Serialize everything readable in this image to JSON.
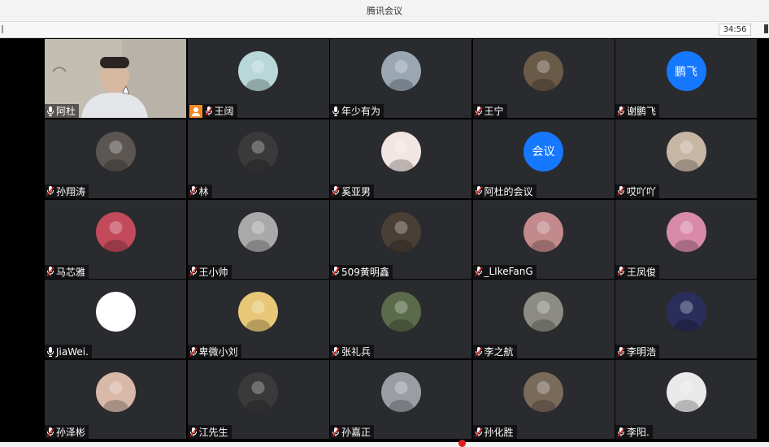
{
  "window": {
    "title": "腾讯会议",
    "timer": "34:56"
  },
  "participants": [
    {
      "name": "阿杜",
      "mic": "on",
      "type": "video"
    },
    {
      "name": "王阔",
      "mic": "muted",
      "type": "photo",
      "host": true,
      "avatar_color": "#b9d6d8"
    },
    {
      "name": "年少有为",
      "mic": "on",
      "type": "photo",
      "avatar_color": "#9aa6b2"
    },
    {
      "name": "王宁",
      "mic": "muted",
      "type": "photo",
      "avatar_color": "#6a5a48"
    },
    {
      "name": "谢鹏飞",
      "mic": "muted",
      "type": "text",
      "avatar_text": "鹏飞",
      "avatar_color": "#1677ff"
    },
    {
      "name": "孙翔涛",
      "mic": "muted",
      "type": "photo",
      "avatar_color": "#5c5652"
    },
    {
      "name": "林",
      "mic": "muted",
      "type": "photo",
      "avatar_color": "#3b3a3a"
    },
    {
      "name": "奚亚男",
      "mic": "muted",
      "type": "photo",
      "avatar_color": "#f1e6e2"
    },
    {
      "name": "阿杜的会议",
      "mic": "muted",
      "type": "text",
      "avatar_text": "会议",
      "avatar_color": "#1677ff"
    },
    {
      "name": "哎吖吖",
      "mic": "muted",
      "type": "photo",
      "avatar_color": "#c8b6a4"
    },
    {
      "name": "马芯雅",
      "mic": "muted",
      "type": "photo",
      "avatar_color": "#c24a5a"
    },
    {
      "name": "王小帅",
      "mic": "muted",
      "type": "photo",
      "avatar_color": "#a9a9a9"
    },
    {
      "name": "509黄明鑫",
      "mic": "muted",
      "type": "photo",
      "avatar_color": "#4a3f36"
    },
    {
      "name": "_LIkeFanG",
      "mic": "muted",
      "type": "photo",
      "avatar_color": "#c28a8a"
    },
    {
      "name": "王凤俊",
      "mic": "muted",
      "type": "photo",
      "avatar_color": "#d88aa8"
    },
    {
      "name": "JiaWei.",
      "mic": "on",
      "type": "blank",
      "avatar_color": "#ffffff"
    },
    {
      "name": "卑微小刘",
      "mic": "muted",
      "type": "photo",
      "avatar_color": "#e8c878"
    },
    {
      "name": "张礼兵",
      "mic": "muted",
      "type": "photo",
      "avatar_color": "#5a6a4a"
    },
    {
      "name": "李之航",
      "mic": "muted",
      "type": "photo",
      "avatar_color": "#8c8c84"
    },
    {
      "name": "李明浩",
      "mic": "muted",
      "type": "photo",
      "avatar_color": "#2a2e5a"
    },
    {
      "name": "孙泽彬",
      "mic": "muted",
      "type": "photo",
      "avatar_color": "#d8b8a8"
    },
    {
      "name": "江先生",
      "mic": "muted",
      "type": "photo",
      "avatar_color": "#3a3a3a"
    },
    {
      "name": "孙嘉正",
      "mic": "muted",
      "type": "photo",
      "avatar_color": "#9a9ea4"
    },
    {
      "name": "孙化胜",
      "mic": "muted",
      "type": "photo",
      "avatar_color": "#7a6a5a"
    },
    {
      "name": "李阳.",
      "mic": "muted",
      "type": "photo",
      "avatar_color": "#e9e9e9"
    }
  ]
}
